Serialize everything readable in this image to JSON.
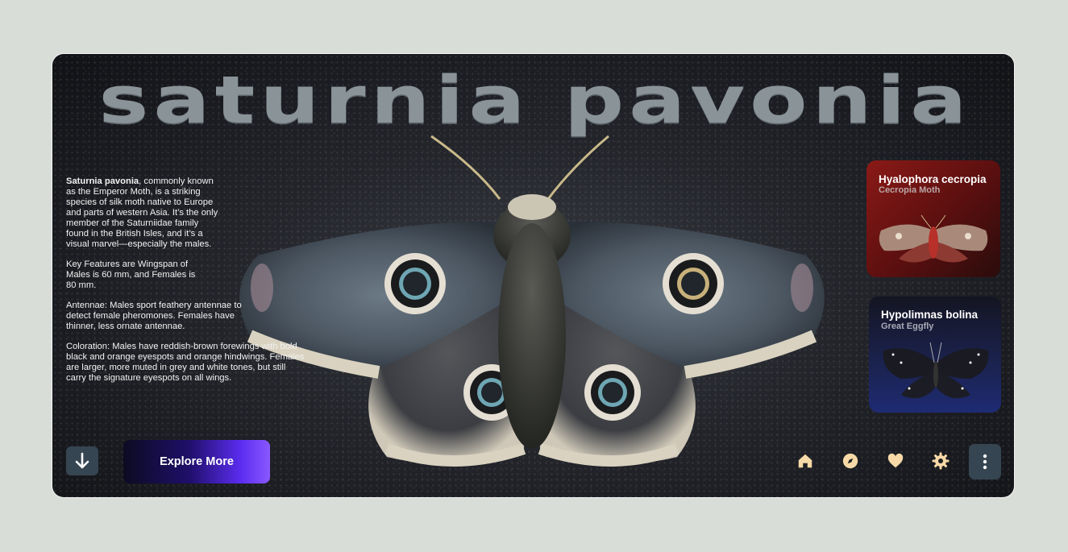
{
  "hero": {
    "title": "Saturnia Pavonia"
  },
  "description": {
    "intro_bold": "Saturnia pavonia",
    "intro_rest": ", commonly known as the Emperor Moth, is a striking species of silk moth native to Europe and parts of western Asia. It’s the only member of the Saturniidae family found in the British Isles, and it’s a visual marvel—especially the males.",
    "key_features": "Key Features are Wingspan of Males is 60 mm, and Females is 80 mm.",
    "antennae": "Antennae: Males sport feathery antennae to detect female pheromones. Females have thinner, less ornate antennae.",
    "coloration": "Coloration: Males have reddish-brown forewings with bold black and orange eyespots and orange hindwings. Females are larger, more muted in grey and white tones, but still carry the signature eyespots on all wings."
  },
  "related": [
    {
      "scientific_name": "Hyalophora cecropia",
      "common_name": "Cecropia Moth",
      "accent": "#8a1a17"
    },
    {
      "scientific_name": "Hypolimnas bolina",
      "common_name": "Great Eggfly",
      "accent": "#1e2b73"
    }
  ],
  "actions": {
    "explore_label": "Explore More",
    "down_icon": "arrow-down-icon",
    "more_icon": "more-vertical-icon"
  },
  "nav": {
    "icons": [
      "home-icon",
      "compass-icon",
      "heart-icon",
      "settings-icon"
    ],
    "icon_color": "#f6d9a6"
  }
}
